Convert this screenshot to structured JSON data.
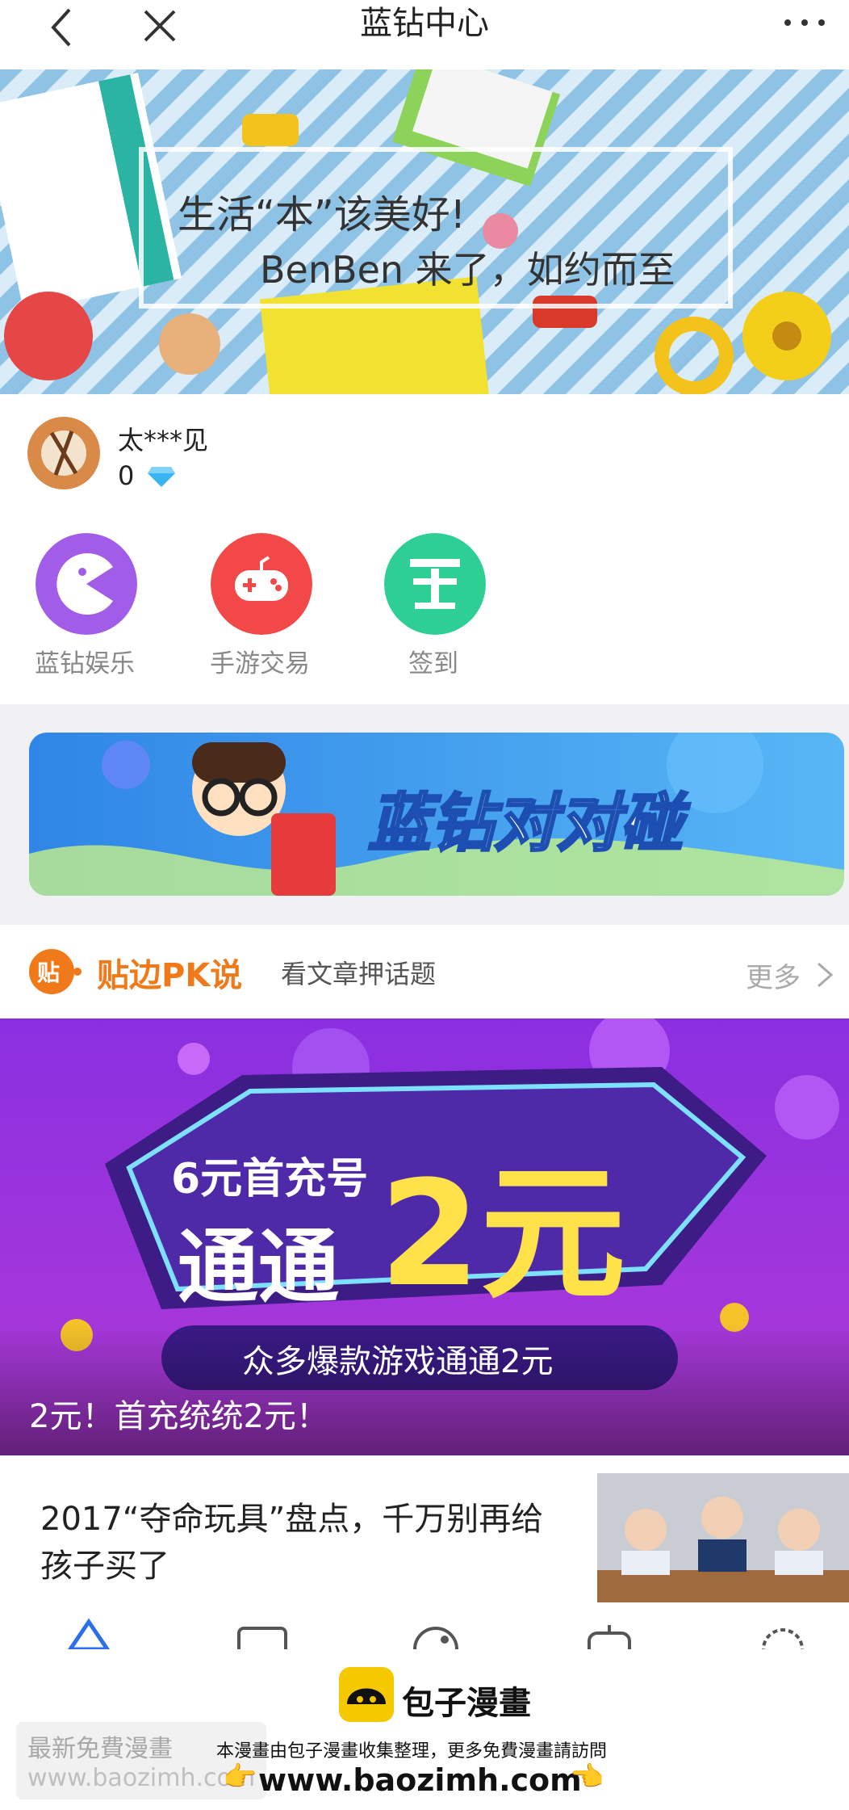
{
  "header": {
    "title": "蓝钻中心"
  },
  "hero_banner": {
    "line1": "生活“本”该美好!",
    "line2": "BenBen 来了，如约而至"
  },
  "user": {
    "name": "太***见",
    "diamond_count": "0"
  },
  "quick_actions": [
    {
      "label": "蓝钻娱乐",
      "color": "#a15de8",
      "icon": "pacman-icon"
    },
    {
      "label": "手游交易",
      "color": "#f24848",
      "icon": "gamepad-icon"
    },
    {
      "label": "签到",
      "color": "#2dcf95",
      "icon": "signin-icon"
    }
  ],
  "promo_banner": {
    "text": "蓝钻对对碰"
  },
  "pk_section": {
    "badge": "贴",
    "name": "贴边PK说",
    "subtitle": "看文章押话题",
    "more": "更多"
  },
  "feature_banner": {
    "line1": "6元首充号",
    "line2": "通通",
    "big": "2元",
    "strip": "众多爆款游戏通通2元",
    "caption": "2元！首充统统2元！"
  },
  "article": {
    "title": "2017“夺命玩具”盘点，千万别再给孩子买了"
  },
  "footer": {
    "brand": "包子漫畫",
    "note": "本漫畫由包子漫畫收集整理，更多免費漫畫請訪問",
    "url": "www.baozimh.com",
    "watermark1": "最新免費漫畫",
    "watermark2": "www.baozimh.com"
  }
}
